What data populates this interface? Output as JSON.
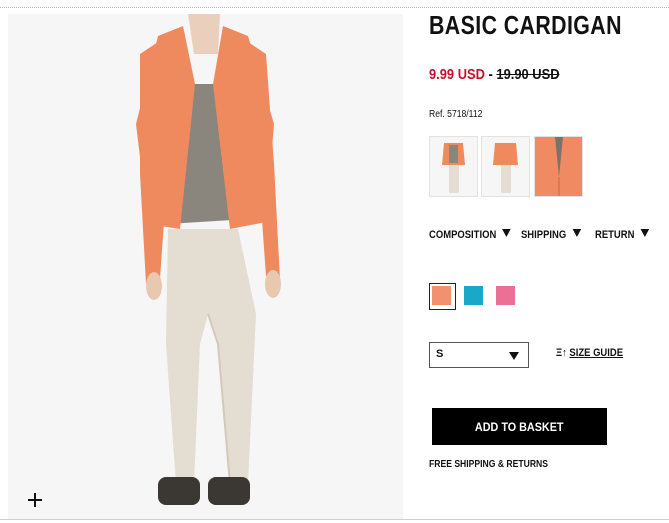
{
  "product": {
    "title": "BASIC CARDIGAN",
    "sale_price": "9.99 USD",
    "price_separator": "-",
    "original_price": "19.90 USD",
    "ref": "Ref. 5718/112"
  },
  "thumbnails": [
    {
      "name": "full-body-view"
    },
    {
      "name": "back-view"
    },
    {
      "name": "detail-view"
    }
  ],
  "tabs": [
    {
      "label": "COMPOSITION",
      "icon": "triangle-down-icon"
    },
    {
      "label": "SHIPPING",
      "icon": "triangle-down-icon"
    },
    {
      "label": "RETURN",
      "icon": "triangle-down-icon"
    }
  ],
  "colors": {
    "swatches": [
      "#f39070",
      "#1aa8c9",
      "#ec6f95"
    ],
    "sale": "#c8102e",
    "button": "#000000"
  },
  "size_select": {
    "value": "S"
  },
  "size_guide": {
    "label": "SIZE GUIDE",
    "icon": "ruler-icon"
  },
  "actions": {
    "add_to_basket": "ADD TO BASKET"
  },
  "shipping_note": "FREE SHIPPING & RETURNS",
  "zoom": {
    "icon": "plus-icon"
  }
}
